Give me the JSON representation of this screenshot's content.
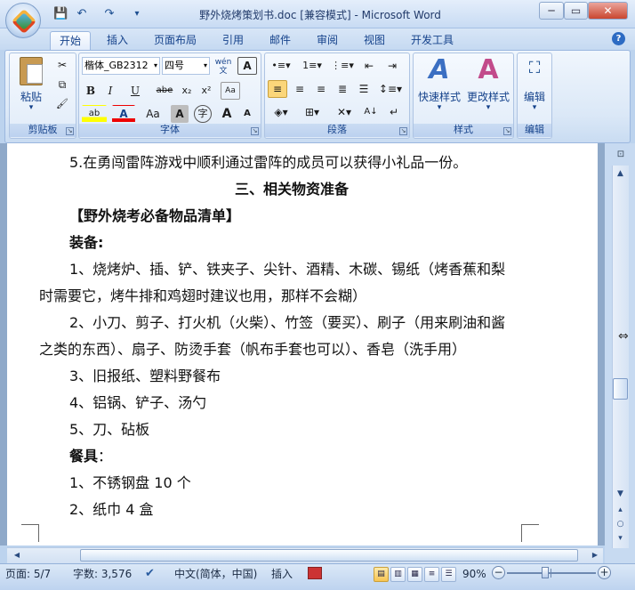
{
  "window": {
    "title": "野外烧烤策划书.doc [兼容模式] - Microsoft Word",
    "minimize": "─",
    "maximize": "▭",
    "close": "✕"
  },
  "qat": {
    "save": "💾",
    "undo": "↶",
    "redo": "↷",
    "customize": "▾"
  },
  "tabs": [
    "开始",
    "插入",
    "页面布局",
    "引用",
    "邮件",
    "审阅",
    "视图",
    "开发工具"
  ],
  "ribbon": {
    "clipboard": {
      "label": "剪贴板",
      "paste": "粘贴",
      "cut_icon": "✂",
      "copy_icon": "⧉",
      "painter_icon": "🖌"
    },
    "font": {
      "label": "字体",
      "font_name": "楷体_GB2312",
      "font_size": "四号",
      "phonetic": "wén 文",
      "border_char": "A",
      "bold": "B",
      "italic": "I",
      "underline": "U",
      "strike": "abe",
      "subscript": "x₂",
      "superscript": "x²",
      "clear": "Aa",
      "highlight": "ab",
      "font_color": "A",
      "case": "Aa",
      "shading": "A",
      "enclosed": "字",
      "grow": "A",
      "shrink": "A"
    },
    "paragraph": {
      "label": "段落"
    },
    "styles": {
      "label": "样式",
      "quick": "快速样式",
      "change": "更改样式"
    },
    "editing": {
      "label": "编辑",
      "edit": "编辑"
    }
  },
  "document": {
    "lines": [
      {
        "text": "5.在勇闯雷阵游戏中顺利通过雷阵的成员可以获得小礼品一份。"
      },
      {
        "text": "三、相关物资准备"
      },
      {
        "text": "【野外烧考必备物品清单】"
      },
      {
        "text": "装备:"
      },
      {
        "text": "1、烧烤炉、插、铲、铁夹子、尖针、酒精、木碳、锡纸（烤香蕉和梨"
      },
      {
        "text": "时需要它，烤牛排和鸡翅时建议也用，那样不会糊）"
      },
      {
        "text": "2、小刀、剪子、打火机（火柴）、竹签（要买）、刷子（用来刷油和酱"
      },
      {
        "text": "之类的东西）、扇子、防烫手套（帆布手套也可以）、香皂（洗手用）"
      },
      {
        "text": "3、旧报纸、塑料野餐布"
      },
      {
        "text": "4、铝锅、铲子、汤勺"
      },
      {
        "text": "5、刀、砧板"
      },
      {
        "text": "餐具"
      },
      {
        "text": "1、不锈钢盘 10 个"
      },
      {
        "text": "2、纸巾 4 盒"
      }
    ],
    "tableware_colon": "："
  },
  "status": {
    "page": "页面: 5/7",
    "words": "字数: 3,576",
    "language": "中文(简体，中国)",
    "mode": "插入",
    "zoom": "90%",
    "zoom_level": 0.9,
    "zoom_minus": "−",
    "zoom_plus": "+"
  },
  "colors": {
    "accent": "#15428b",
    "ribbon_bg": "#dbe8f7",
    "page_bg": "#ffffff"
  }
}
